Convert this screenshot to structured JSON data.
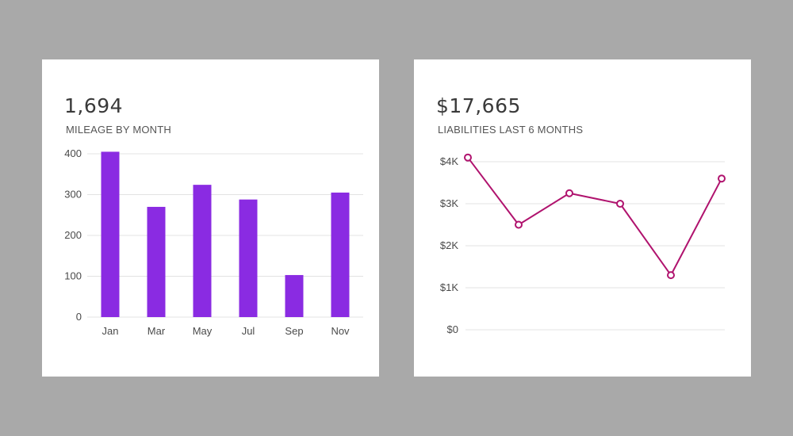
{
  "cards": [
    {
      "metric": "1,694",
      "subtitle": "MILEAGE BY MONTH"
    },
    {
      "metric": "$17,665",
      "subtitle": "LIABILITIES LAST 6 MONTHS"
    }
  ],
  "colors": {
    "background": "#a9a9a9",
    "card": "#ffffff",
    "bar": "#8a2be2",
    "line": "#b0136e",
    "grid": "#e3e3e3"
  },
  "chart_data": [
    {
      "type": "bar",
      "categories": [
        "Jan",
        "Mar",
        "May",
        "Jul",
        "Sep",
        "Nov"
      ],
      "values": [
        405,
        270,
        324,
        288,
        103,
        305
      ],
      "ylim": [
        0,
        400
      ],
      "yticks": [
        "0",
        "100",
        "200",
        "300",
        "400"
      ],
      "ytick_values": [
        0,
        100,
        200,
        300,
        400
      ],
      "grid": true
    },
    {
      "type": "line",
      "values": [
        4100,
        2500,
        3250,
        3000,
        1300,
        3600
      ],
      "ylim": [
        0,
        4000
      ],
      "yticks": [
        "$0",
        "$1K",
        "$2K",
        "$3K",
        "$4K"
      ],
      "ytick_values": [
        0,
        1000,
        2000,
        3000,
        4000
      ],
      "grid": true
    }
  ]
}
